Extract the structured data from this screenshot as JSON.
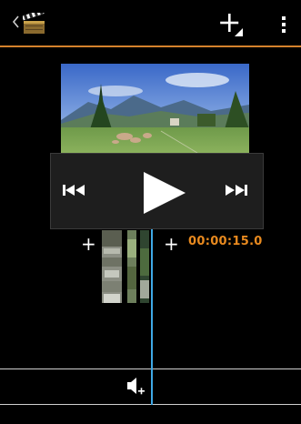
{
  "actionbar": {
    "back_icon": "chevron-left-icon",
    "app_icon": "clapperboard-icon",
    "add_icon": "add-media-icon",
    "menu_icon": "overflow-menu-icon",
    "accent_color": "#d4822c"
  },
  "preview": {
    "image_description_icon": "landscape-thumbnail"
  },
  "controls": {
    "prev_icon": "skip-previous-icon",
    "play_icon": "play-icon",
    "next_icon": "skip-next-icon"
  },
  "timeline": {
    "add_before_label": "+",
    "add_after_label": "+",
    "timecode": "00:00:15.0",
    "timecode_color": "#e98a1f",
    "playhead_color": "#3fa9e6"
  },
  "audio": {
    "add_audio_icon": "speaker-add-icon"
  }
}
